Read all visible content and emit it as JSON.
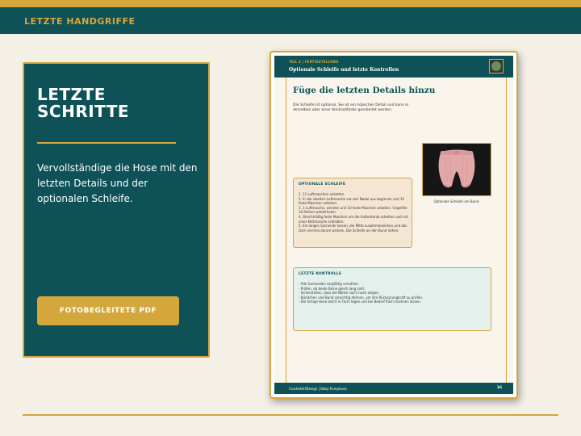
{
  "header": {
    "title": "LETZTE HANDGRIFFE"
  },
  "card": {
    "heading": "LETZTE SCHRITTE",
    "text": "Vervollständige die Hose mit den letzten Details und der optionalen Schleife.",
    "button_label": "FOTOBEGLEITETE PDF"
  },
  "document": {
    "section": "TEIL 4 | FERTIGSTELLUNG",
    "header_title": "Optionale Schleife und letzte Kontrollen",
    "title": "Füge die letzten Details hinzu",
    "intro": "Die Schleife ist optional. Sie ist ein hübsches Detail und kann in derselben oder einer Kontrastfarbe gearbeitet werden.",
    "photo_caption": "Optionale Schleife am Bund.",
    "schleife": {
      "title": "OPTIONALE SCHLEIFE",
      "items": [
        "1. 11 Luftmaschen anketten.",
        "2. In der zweiten Luftmasche von der Nadel aus beginnen und 10 feste Maschen arbeiten.",
        "3. 1 Luftmasche, wenden und 10 feste Maschen arbeiten. Ungefähr 10 Reihen wiederholen.",
        "4. Gleichmäßig feste Maschen um die Außenkante arbeiten und mit einer Kettmasche schließen.",
        "5. Ein langes Garnende lassen, die Mitte zusammenziehen und das Garn viermal darum wickeln. Die Schleife an den Bund nähen."
      ]
    },
    "kontrolle": {
      "title": "LETZTE KONTROLLE",
      "items": [
        "- Alle Garnenden sorgfältig vernähen.",
        "- Prüfen, ob beide Beine gleich lang sind.",
        "- Sicherstellen, dass die Nähte nach innen zeigen.",
        "- Bündchen und Bund vorsichtig dehnen, um ihre Rücksprungkraft zu prüfen.",
        "- Die fertige Hose leicht in Form legen und bei Bedarf flach trocknen lassen."
      ]
    },
    "footer": "CrochetArtDesign  |  Baby-Pumphose",
    "page_number": "16"
  },
  "colors": {
    "teal": "#0e5257",
    "gold": "#d4a73c",
    "background": "#f5f0e6",
    "yarn_pink": "#e2a7a7"
  }
}
